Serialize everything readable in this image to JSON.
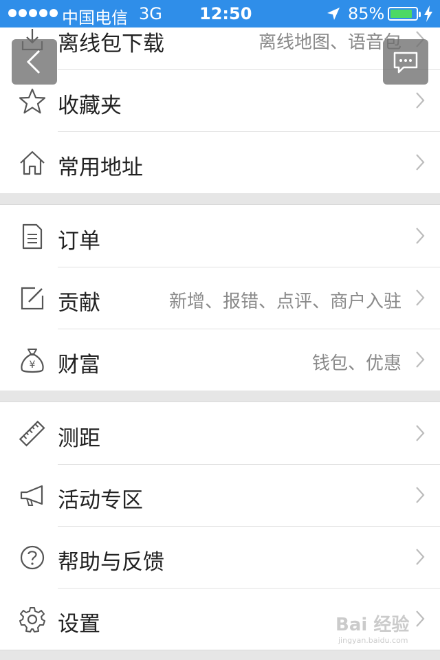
{
  "status_bar": {
    "carrier": "中国电信",
    "network": "3G",
    "time": "12:50",
    "battery": "85%",
    "battery_level": 0.85,
    "accent_color": "#2f8ee9"
  },
  "menu": {
    "groups": [
      {
        "items": [
          {
            "label": "离线包下载",
            "desc": "离线地图、语音包",
            "icon": "download-icon"
          },
          {
            "label": "收藏夹",
            "desc": "",
            "icon": "star-icon"
          },
          {
            "label": "常用地址",
            "desc": "",
            "icon": "home-icon"
          }
        ]
      },
      {
        "items": [
          {
            "label": "订单",
            "desc": "",
            "icon": "document-icon"
          },
          {
            "label": "贡献",
            "desc": "新增、报错、点评、商户入驻",
            "icon": "edit-icon"
          },
          {
            "label": "财富",
            "desc": "钱包、优惠",
            "icon": "money-bag-icon"
          }
        ]
      },
      {
        "items": [
          {
            "label": "测距",
            "desc": "",
            "icon": "ruler-icon"
          },
          {
            "label": "活动专区",
            "desc": "",
            "icon": "megaphone-icon"
          },
          {
            "label": "帮助与反馈",
            "desc": "",
            "icon": "help-icon"
          },
          {
            "label": "设置",
            "desc": "",
            "icon": "gear-icon"
          }
        ]
      }
    ]
  },
  "watermark": {
    "text": "Bai 经验",
    "sub": "jingyan.baidu.com"
  }
}
